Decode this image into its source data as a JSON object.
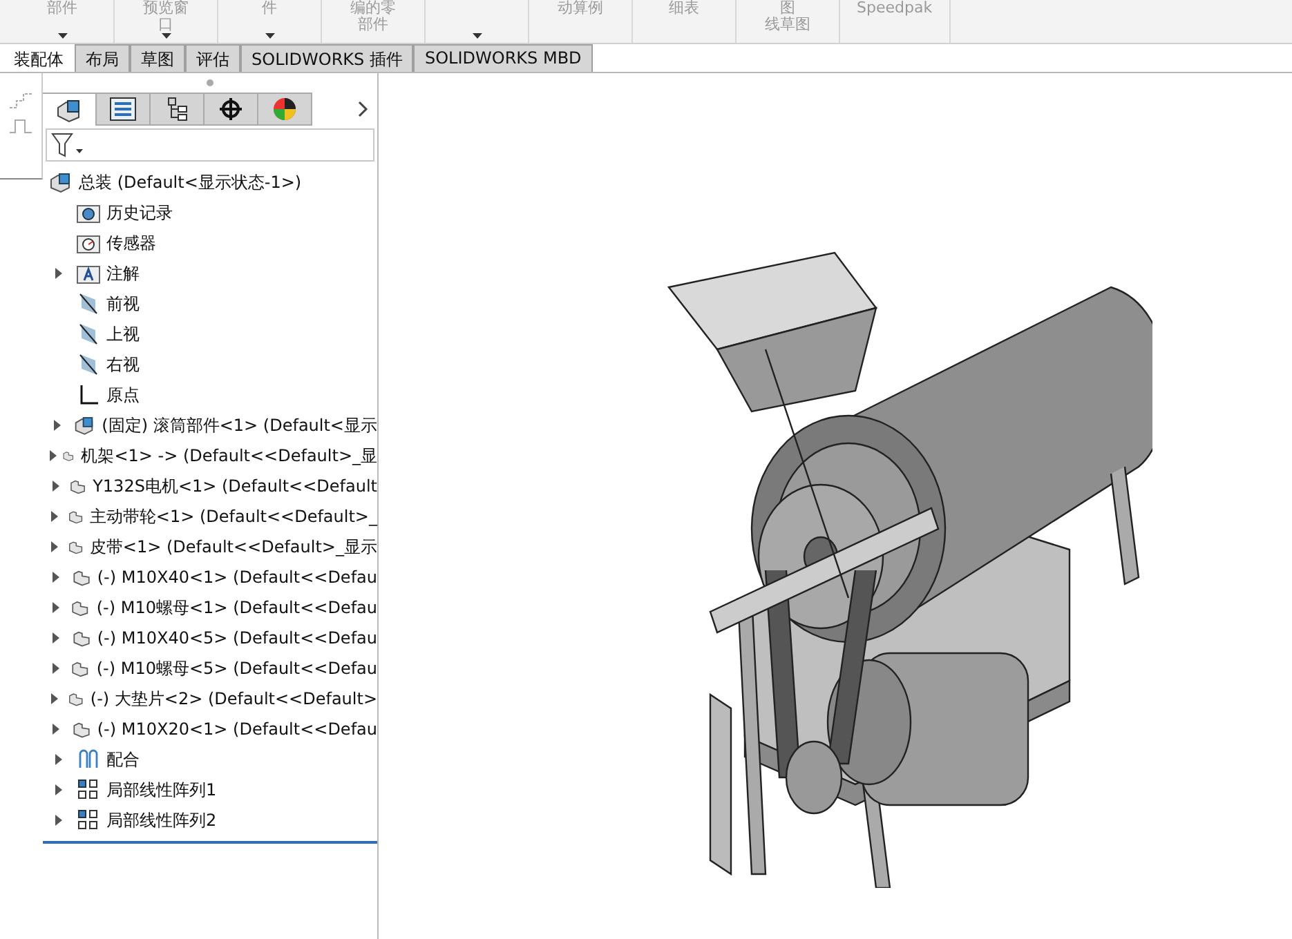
{
  "toolbar": {
    "groups": [
      {
        "lines": [
          "部件"
        ],
        "dropdown": true
      },
      {
        "lines": [
          "预览窗",
          "口"
        ],
        "dropdown": true
      },
      {
        "lines": [
          "件"
        ],
        "dropdown": true
      },
      {
        "lines": [
          "编的零",
          "部件"
        ],
        "dropdown": false
      },
      {
        "dropdown": true
      },
      {
        "lines": [
          "动算例"
        ],
        "dropdown": false
      },
      {
        "lines": [
          "细表"
        ],
        "dropdown": false
      },
      {
        "lines": [
          "图",
          "线草图"
        ],
        "dropdown": false
      },
      {
        "lines": [
          "Speedpak"
        ],
        "dropdown": false
      }
    ]
  },
  "tabs": [
    {
      "label": "装配体",
      "selected": true
    },
    {
      "label": "布局",
      "selected": false
    },
    {
      "label": "草图",
      "selected": false
    },
    {
      "label": "评估",
      "selected": false
    },
    {
      "label": "SOLIDWORKS 插件",
      "selected": false
    },
    {
      "label": "SOLIDWORKS MBD",
      "selected": false
    }
  ],
  "panel_tabs": [
    {
      "kind": "feature-tree",
      "selected": true
    },
    {
      "kind": "property",
      "selected": false
    },
    {
      "kind": "config",
      "selected": false
    },
    {
      "kind": "dimxpert",
      "selected": false
    },
    {
      "kind": "display",
      "selected": false
    }
  ],
  "tree": {
    "root": {
      "kind": "assembly",
      "label": "总装  (Default<显示状态-1>)",
      "children": [
        {
          "kind": "history",
          "label": "历史记录",
          "expandable": false
        },
        {
          "kind": "sensor",
          "label": "传感器",
          "expandable": false
        },
        {
          "kind": "annotation",
          "label": "注解",
          "expandable": true
        },
        {
          "kind": "plane",
          "label": "前视",
          "expandable": false
        },
        {
          "kind": "plane",
          "label": "上视",
          "expandable": false
        },
        {
          "kind": "plane",
          "label": "右视",
          "expandable": false
        },
        {
          "kind": "origin",
          "label": "原点",
          "expandable": false
        },
        {
          "kind": "subassembly",
          "label": "(固定) 滚筒部件<1> (Default<显示",
          "expandable": true
        },
        {
          "kind": "part",
          "label": "机架<1> -> (Default<<Default>_显",
          "expandable": true
        },
        {
          "kind": "part",
          "label": "Y132S电机<1> (Default<<Default",
          "expandable": true
        },
        {
          "kind": "part",
          "label": "主动带轮<1> (Default<<Default>_",
          "expandable": true
        },
        {
          "kind": "part",
          "label": "皮带<1> (Default<<Default>_显示",
          "expandable": true
        },
        {
          "kind": "part",
          "label": "(-) M10X40<1> (Default<<Defau",
          "expandable": true
        },
        {
          "kind": "part",
          "label": "(-) M10螺母<1> (Default<<Defau",
          "expandable": true
        },
        {
          "kind": "part",
          "label": "(-) M10X40<5> (Default<<Defau",
          "expandable": true
        },
        {
          "kind": "part",
          "label": "(-) M10螺母<5> (Default<<Defau",
          "expandable": true
        },
        {
          "kind": "part",
          "label": "(-) 大垫片<2> (Default<<Default>",
          "expandable": true
        },
        {
          "kind": "part",
          "label": "(-) M10X20<1> (Default<<Defau",
          "expandable": true
        },
        {
          "kind": "mates",
          "label": "配合",
          "expandable": true
        },
        {
          "kind": "pattern",
          "label": "局部线性阵列1",
          "expandable": true
        },
        {
          "kind": "pattern",
          "label": "局部线性阵列2",
          "expandable": true
        }
      ]
    }
  }
}
